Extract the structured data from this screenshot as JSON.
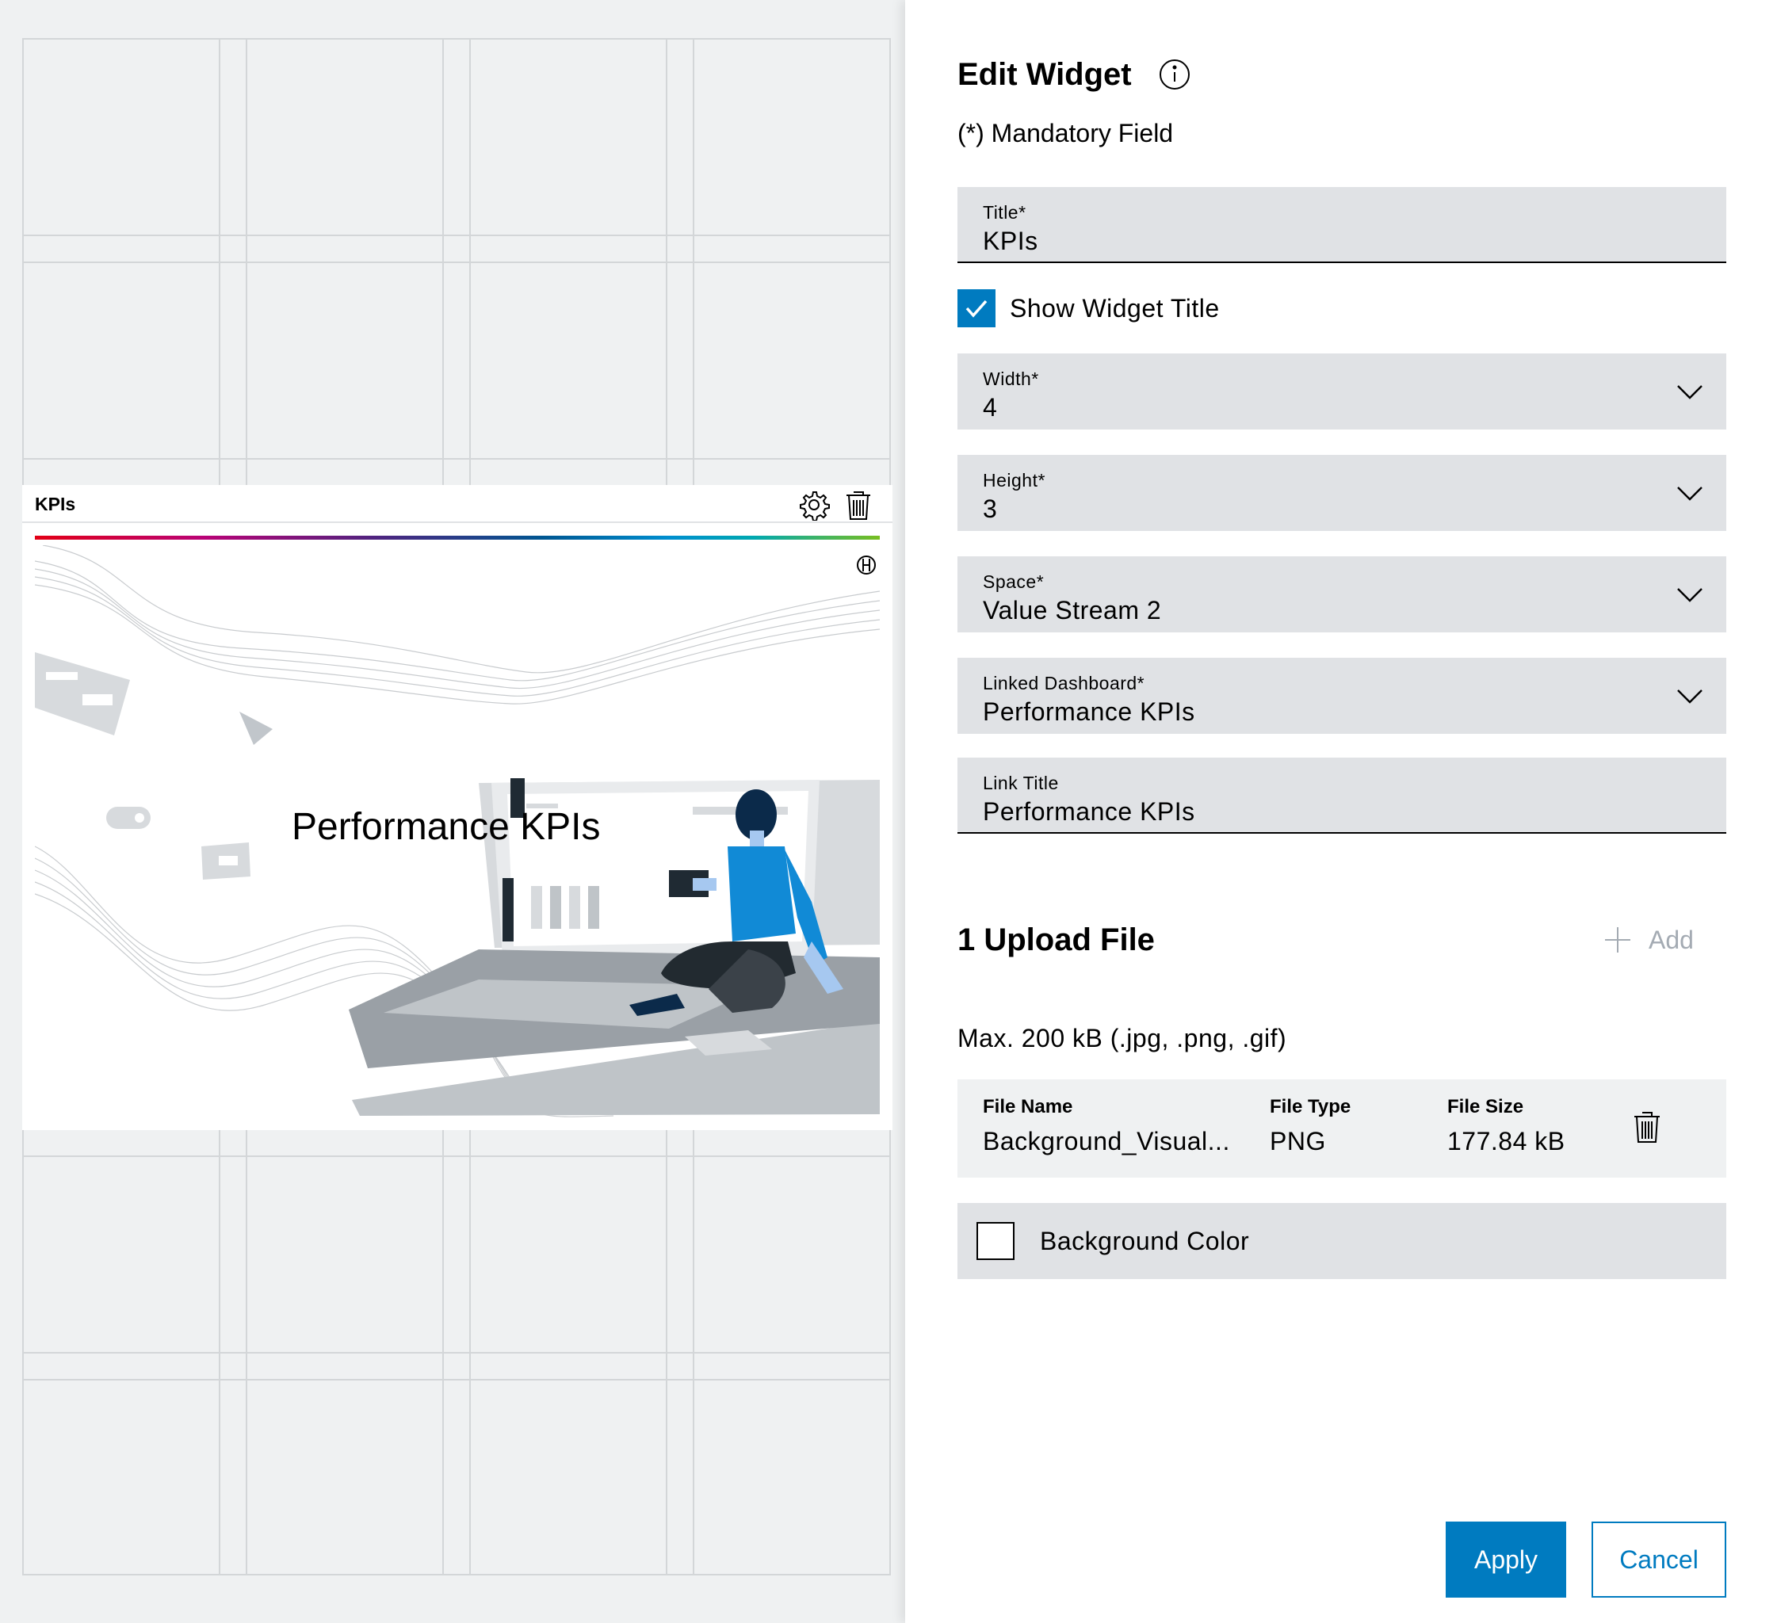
{
  "widget": {
    "title": "KPIs",
    "banner_text": "Performance KPIs",
    "settings_icon": "gear-icon",
    "delete_icon": "trash-icon"
  },
  "panel": {
    "title": "Edit Widget",
    "mandatory_note": "(*) Mandatory Field",
    "fields": {
      "title": {
        "label": "Title*",
        "value": "KPIs"
      },
      "show_title": {
        "label": "Show Widget Title",
        "checked": true
      },
      "width": {
        "label": "Width*",
        "value": "4"
      },
      "height": {
        "label": "Height*",
        "value": "3"
      },
      "space": {
        "label": "Space*",
        "value": "Value Stream 2"
      },
      "linked_dashboard": {
        "label": "Linked Dashboard*",
        "value": "Performance KPIs"
      },
      "link_title": {
        "label": "Link Title",
        "value": "Performance KPIs"
      }
    },
    "upload": {
      "section_title": "1 Upload File",
      "add_label": "Add",
      "hint": "Max. 200 kB (.jpg, .png, .gif)",
      "columns": {
        "name": "File Name",
        "type": "File Type",
        "size": "File Size"
      },
      "file": {
        "name": "Background_Visual...",
        "type": "PNG",
        "size": "177.84 kB"
      }
    },
    "background_color": {
      "label": "Background Color",
      "checked": false
    },
    "buttons": {
      "apply": "Apply",
      "cancel": "Cancel"
    }
  },
  "colors": {
    "accent": "#007bc0",
    "field_bg": "#e0e2e5",
    "canvas_bg": "#eff1f2",
    "disabled": "#a4abb3"
  }
}
